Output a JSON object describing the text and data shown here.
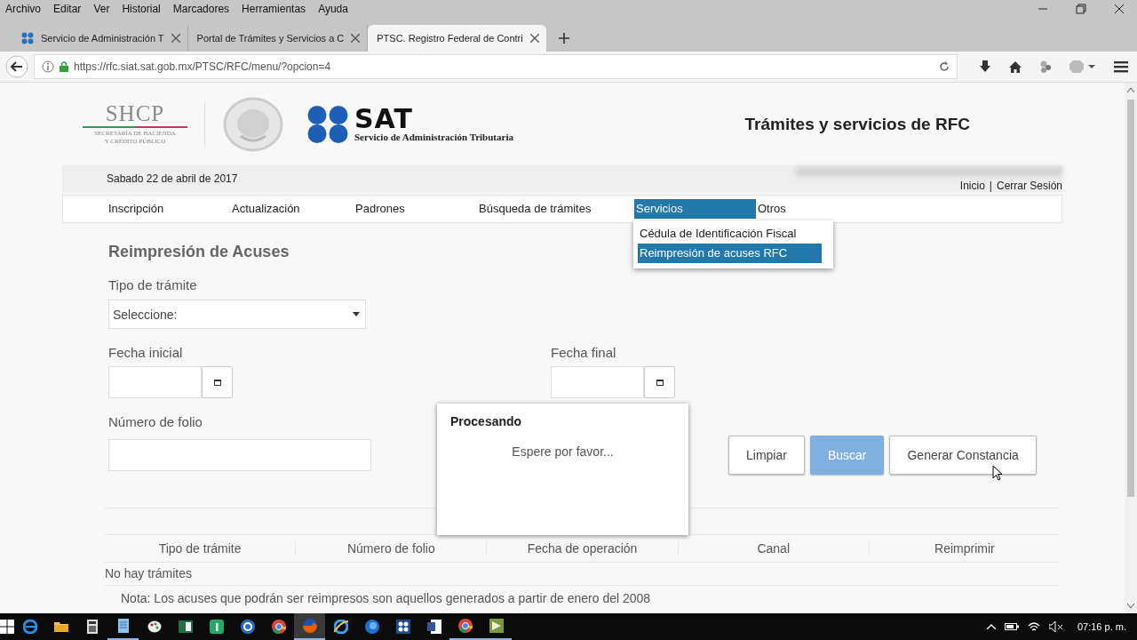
{
  "menu_bar": [
    "Archivo",
    "Editar",
    "Ver",
    "Historial",
    "Marcadores",
    "Herramientas",
    "Ayuda"
  ],
  "tabs": [
    {
      "title": "Servicio de Administración T",
      "selected": false
    },
    {
      "title": "Portal de Trámites y Servicios a C",
      "selected": false
    },
    {
      "title": "PTSC. Registro Federal de Contri",
      "selected": true
    }
  ],
  "address": {
    "url": "https://rfc.siat.sat.gob.mx/PTSC/RFC/menu/?opcion=4"
  },
  "header": {
    "shcp": {
      "acronym": "SHCP",
      "lines": [
        "SECRETARÍA DE HACIENDA",
        "Y CRÉDITO PÚBLICO"
      ]
    },
    "sat": {
      "acronym": "SAT",
      "name": "Servicio de Administración Tributaria"
    },
    "title": "Trámites y servicios de RFC"
  },
  "date": "Sabado 22 de abril de 2017",
  "session_links": {
    "items": [
      "Inicio",
      "Cerrar Sesión"
    ],
    "separator": "|"
  },
  "nav": [
    {
      "label": "Inscripción",
      "selected": false
    },
    {
      "label": "Actualización",
      "selected": false
    },
    {
      "label": "Padrones",
      "selected": false
    },
    {
      "label": "Búsqueda de trámites",
      "selected": false
    },
    {
      "label": "Servicios",
      "selected": true
    },
    {
      "label": "Otros",
      "selected": false
    }
  ],
  "dropdown": [
    {
      "label": "Cédula de Identificación Fiscal",
      "selected": false
    },
    {
      "label": "Reimpresión de acuses RFC",
      "selected": true
    }
  ],
  "form": {
    "title": "Reimpresión de Acuses",
    "tipo": {
      "label": "Tipo de trámite",
      "value": "Seleccione:"
    },
    "fecha_inicial": {
      "label": "Fecha inicial"
    },
    "fecha_final": {
      "label": "Fecha final"
    },
    "folio": {
      "label": "Número de folio"
    },
    "buttons": [
      {
        "label": "Limpiar",
        "kind": "default"
      },
      {
        "label": "Buscar",
        "kind": "primary"
      },
      {
        "label": "Generar Constancia",
        "kind": "default"
      }
    ]
  },
  "dialog": {
    "title": "Procesando",
    "message": "Espere por favor..."
  },
  "table": {
    "columns": [
      "Tipo de trámite",
      "Número de folio",
      "Fecha de operación",
      "Canal",
      "Reimprimir"
    ],
    "empty_message": "No hay trámites"
  },
  "note": "Nota: Los acuses que podrán ser reimpresos son aquellos generados a partir de enero del 2008",
  "taskbar": {
    "apps": [
      {
        "running": false,
        "selected": false
      },
      {
        "running": false,
        "selected": false
      },
      {
        "running": false,
        "selected": false
      },
      {
        "running": true,
        "selected": false
      },
      {
        "running": false,
        "selected": false
      },
      {
        "running": false,
        "selected": false
      },
      {
        "running": false,
        "selected": false
      },
      {
        "running": false,
        "selected": false
      },
      {
        "running": false,
        "selected": false
      },
      {
        "running": true,
        "selected": true
      },
      {
        "running": false,
        "selected": false
      },
      {
        "running": false,
        "selected": false
      },
      {
        "running": false,
        "selected": false
      },
      {
        "running": false,
        "selected": false
      },
      {
        "running": true,
        "selected": false
      },
      {
        "running": true,
        "selected": false
      }
    ],
    "clock": "07:16 p. m."
  }
}
